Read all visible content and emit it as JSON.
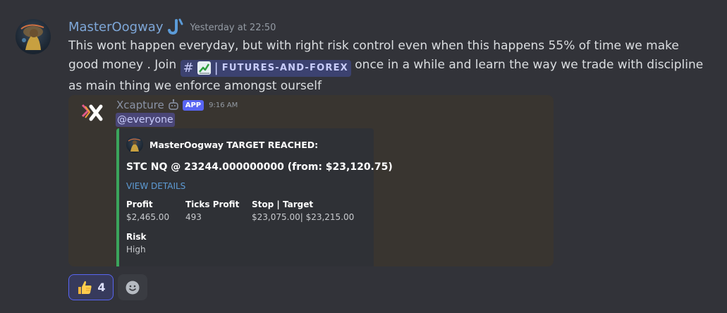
{
  "message": {
    "author": "MasterOogway",
    "timestamp": "Yesterday at 22:50",
    "text_before": "This wont happen everyday, but with right risk control even when this happens 55% of time we make good money . Join ",
    "text_after": " once in a while and learn the way we trade with discipline as main thing we enforce amongst ourself",
    "channel": {
      "hash": "#",
      "separator": "|",
      "name": "FUTURES-AND-FOREX",
      "emoji_icon": "chart-increasing-icon"
    }
  },
  "bot": {
    "name": "Xcapture",
    "badge": "APP",
    "time": "9:16 AM",
    "mention": "@everyone"
  },
  "embed": {
    "accent_color": "#3ba55c",
    "author": "MasterOogway TARGET REACHED:",
    "title": "STC NQ @ 23244.000000000 (from: $23,120.75)",
    "link_label": "VIEW DETAILS",
    "fields": {
      "profit": {
        "name": "Profit",
        "value": "$2,465.00"
      },
      "ticks": {
        "name": "Ticks Profit",
        "value": "493"
      },
      "stop_target": {
        "name": "Stop | Target",
        "value": "$23,075.00| $23,215.00"
      },
      "risk": {
        "name": "Risk",
        "value": "High"
      }
    }
  },
  "reactions": {
    "thumbs_up": {
      "icon": "thumbs-up-icon",
      "count": "4"
    },
    "add": {
      "icon": "smiley-add-icon"
    }
  }
}
